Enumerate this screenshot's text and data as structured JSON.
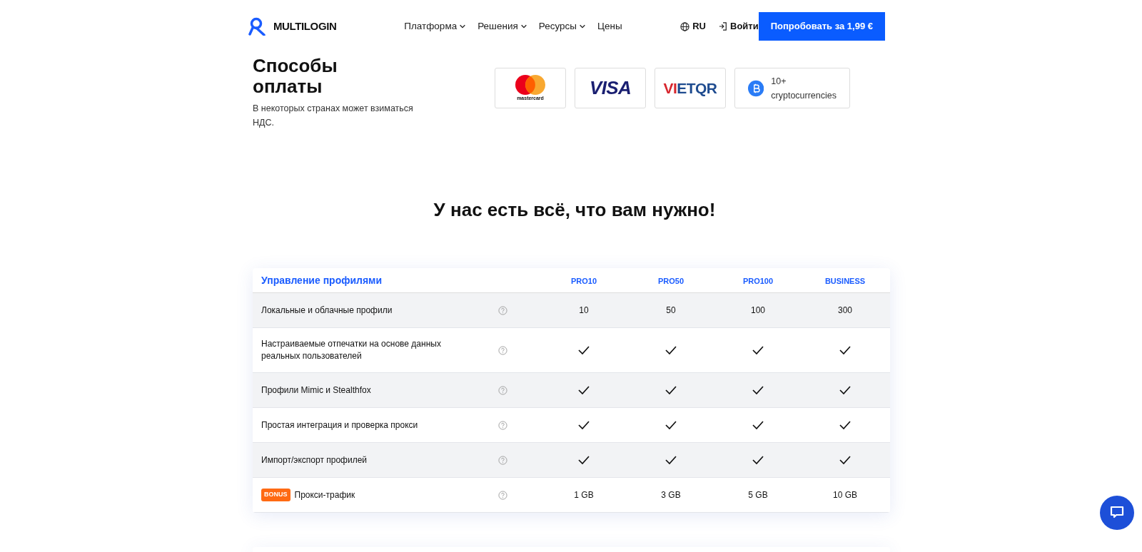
{
  "header": {
    "logo": "MULTILOGIN",
    "nav": [
      {
        "label": "Платформа",
        "dropdown": true
      },
      {
        "label": "Решения",
        "dropdown": true
      },
      {
        "label": "Ресурсы",
        "dropdown": true
      },
      {
        "label": "Цены",
        "dropdown": false
      }
    ],
    "language": "RU",
    "login": "Войти",
    "cta": "Попробовать за 1,99 €"
  },
  "payment": {
    "title": "Способы оплаты",
    "note": "В некоторых странах может взиматься НДС.",
    "methods": [
      {
        "kind": "mastercard",
        "label": "mastercard"
      },
      {
        "kind": "visa",
        "label": "VISA"
      },
      {
        "kind": "vietqr",
        "label": "VIETQR"
      },
      {
        "kind": "crypto",
        "label": "10+ cryptocurrencies"
      }
    ]
  },
  "heading": "У нас есть всё, что вам нужно!",
  "table": {
    "title": "Управление профилями",
    "columns": [
      "PRO10",
      "PRO50",
      "PRO100",
      "BUSINESS"
    ],
    "rows": [
      {
        "label": "Локальные и облачные профили",
        "cells": [
          {
            "kind": "text",
            "text": "10"
          },
          {
            "kind": "text",
            "text": "50"
          },
          {
            "kind": "text",
            "text": "100"
          },
          {
            "kind": "text",
            "text": "300"
          }
        ]
      },
      {
        "label": "Настраиваемые отпечатки на основе данных реальных пользователей",
        "cells": [
          {
            "kind": "check"
          },
          {
            "kind": "check"
          },
          {
            "kind": "check"
          },
          {
            "kind": "check"
          }
        ]
      },
      {
        "label": "Профили Mimic и Stealthfox",
        "cells": [
          {
            "kind": "check"
          },
          {
            "kind": "check"
          },
          {
            "kind": "check"
          },
          {
            "kind": "check"
          }
        ]
      },
      {
        "label": "Простая интеграция и проверка прокси",
        "cells": [
          {
            "kind": "check"
          },
          {
            "kind": "check"
          },
          {
            "kind": "check"
          },
          {
            "kind": "check"
          }
        ]
      },
      {
        "label": "Импорт/экспорт профилей",
        "cells": [
          {
            "kind": "check"
          },
          {
            "kind": "check"
          },
          {
            "kind": "check"
          },
          {
            "kind": "check"
          }
        ]
      },
      {
        "label": "Прокси-трафик",
        "badge": "BONUS",
        "cells": [
          {
            "kind": "text",
            "text": "1 GB"
          },
          {
            "kind": "text",
            "text": "3 GB"
          },
          {
            "kind": "text",
            "text": "5 GB"
          },
          {
            "kind": "text",
            "text": "10 GB"
          }
        ]
      }
    ]
  }
}
